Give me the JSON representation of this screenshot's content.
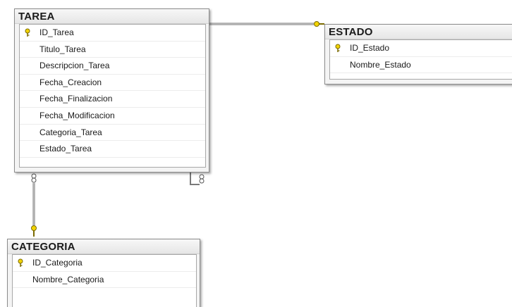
{
  "tables": {
    "tarea": {
      "title": "TAREA",
      "columns": [
        {
          "name": "ID_Tarea",
          "primary_key": true
        },
        {
          "name": "Titulo_Tarea",
          "primary_key": false
        },
        {
          "name": "Descripcion_Tarea",
          "primary_key": false
        },
        {
          "name": "Fecha_Creacion",
          "primary_key": false
        },
        {
          "name": "Fecha_Finalizacion",
          "primary_key": false
        },
        {
          "name": "Fecha_Modificacion",
          "primary_key": false
        },
        {
          "name": "Categoria_Tarea",
          "primary_key": false
        },
        {
          "name": "Estado_Tarea",
          "primary_key": false
        }
      ]
    },
    "estado": {
      "title": "ESTADO",
      "columns": [
        {
          "name": "ID_Estado",
          "primary_key": true
        },
        {
          "name": "Nombre_Estado",
          "primary_key": false
        }
      ]
    },
    "categoria": {
      "title": "CATEGORIA",
      "columns": [
        {
          "name": "ID_Categoria",
          "primary_key": true
        },
        {
          "name": "Nombre_Categoria",
          "primary_key": false
        }
      ]
    }
  },
  "relationships": [
    {
      "from": "tarea",
      "to": "estado",
      "from_end": "many",
      "to_end": "one"
    },
    {
      "from": "tarea",
      "to": "categoria",
      "from_end": "many",
      "to_end": "one"
    },
    {
      "from": "tarea",
      "to": "tarea",
      "from_end": "many",
      "to_end": "many"
    }
  ],
  "colors": {
    "key_icon": "#e8c400",
    "connector": "#7a7a7a"
  }
}
